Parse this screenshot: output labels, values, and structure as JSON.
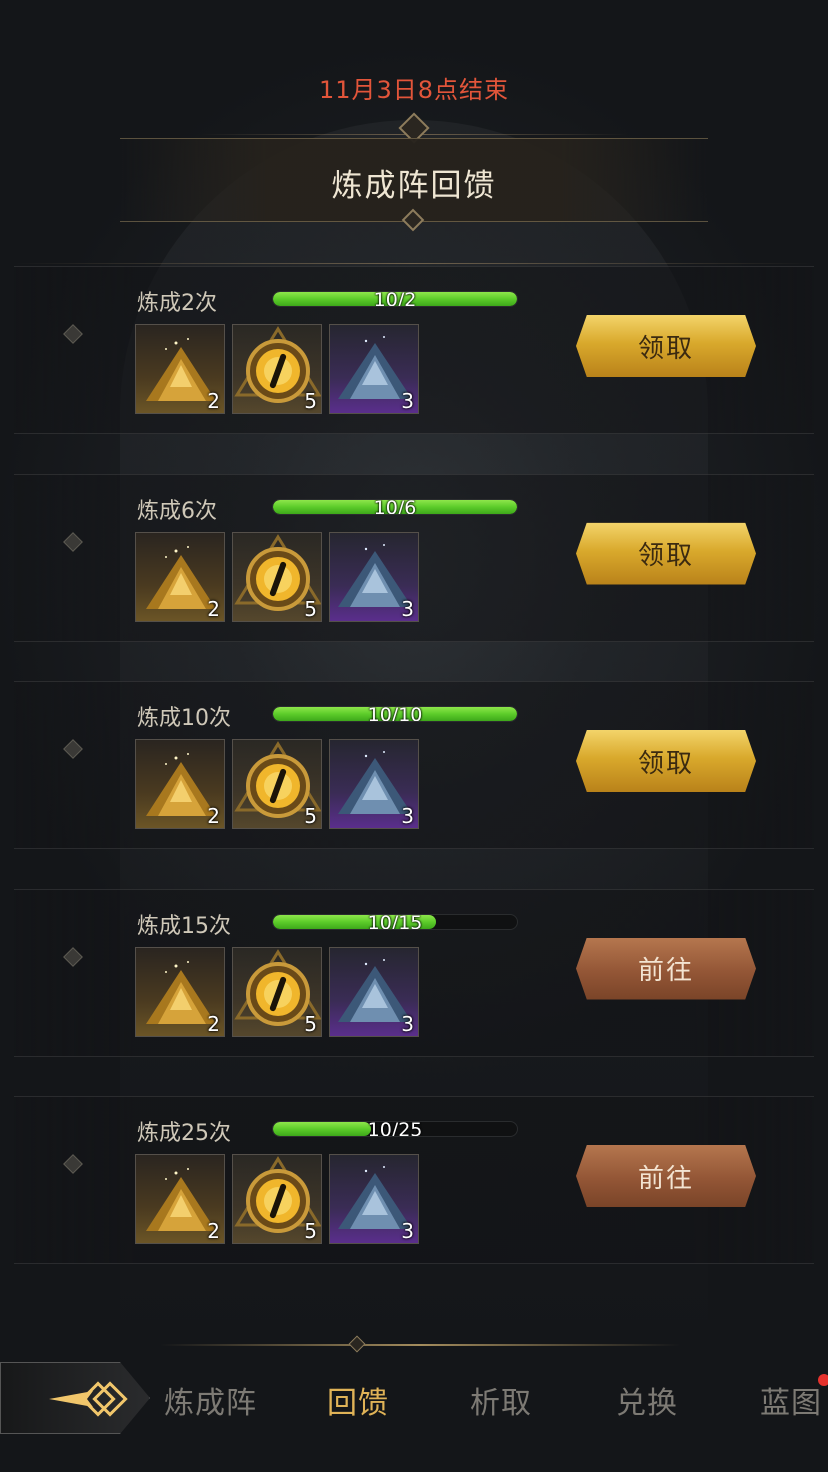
{
  "header": {
    "timer": "11月3日8点结束",
    "title": "炼成阵回馈"
  },
  "milestones": [
    {
      "label": "炼成2次",
      "progress_text": "10/2",
      "progress": 1.0,
      "rewards": [
        {
          "icon": "gold-ore-pile-icon",
          "count": "2"
        },
        {
          "icon": "golden-eye-orb-icon",
          "count": "5"
        },
        {
          "icon": "blue-crystal-pile-icon",
          "count": "3"
        }
      ],
      "button": "领取",
      "button_type": "claim"
    },
    {
      "label": "炼成6次",
      "progress_text": "10/6",
      "progress": 1.0,
      "rewards": [
        {
          "icon": "gold-ore-pile-icon",
          "count": "2"
        },
        {
          "icon": "golden-eye-orb-icon",
          "count": "5"
        },
        {
          "icon": "blue-crystal-pile-icon",
          "count": "3"
        }
      ],
      "button": "领取",
      "button_type": "claim"
    },
    {
      "label": "炼成10次",
      "progress_text": "10/10",
      "progress": 1.0,
      "rewards": [
        {
          "icon": "gold-ore-pile-icon",
          "count": "2"
        },
        {
          "icon": "golden-eye-orb-icon",
          "count": "5"
        },
        {
          "icon": "blue-crystal-pile-icon",
          "count": "3"
        }
      ],
      "button": "领取",
      "button_type": "claim"
    },
    {
      "label": "炼成15次",
      "progress_text": "10/15",
      "progress": 0.667,
      "rewards": [
        {
          "icon": "gold-ore-pile-icon",
          "count": "2"
        },
        {
          "icon": "golden-eye-orb-icon",
          "count": "5"
        },
        {
          "icon": "blue-crystal-pile-icon",
          "count": "3"
        }
      ],
      "button": "前往",
      "button_type": "goto"
    },
    {
      "label": "炼成25次",
      "progress_text": "10/25",
      "progress": 0.4,
      "rewards": [
        {
          "icon": "gold-ore-pile-icon",
          "count": "2"
        },
        {
          "icon": "golden-eye-orb-icon",
          "count": "5"
        },
        {
          "icon": "blue-crystal-pile-icon",
          "count": "3"
        }
      ],
      "button": "前往",
      "button_type": "goto"
    }
  ],
  "nav": {
    "back_icon": "back-arrow-icon",
    "tabs": [
      "炼成阵",
      "回馈",
      "析取",
      "兑换",
      "蓝图"
    ],
    "active_index": 1,
    "notification_on_tab": 4
  },
  "colors": {
    "timer": "#e2553a",
    "progress_green": "#5ccc2a",
    "claim_gold": "#d9a92c",
    "goto_copper": "#935636",
    "active_tab": "#e0b357"
  }
}
